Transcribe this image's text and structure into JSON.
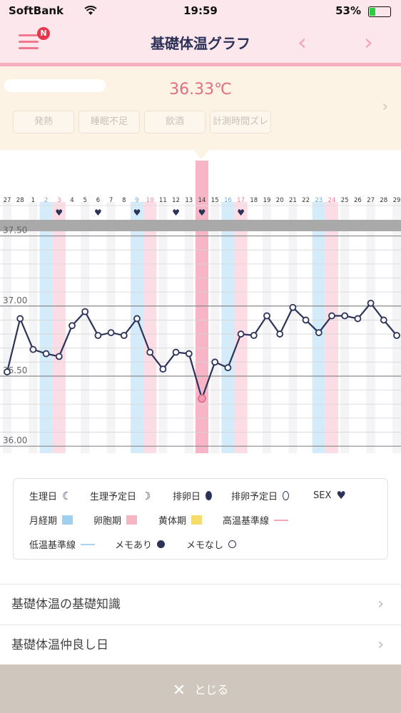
{
  "status_bar": {
    "carrier": "SoftBank",
    "time": "19:59",
    "battery": "53%"
  },
  "nav": {
    "badge": "N",
    "title": "基礎体温グラフ",
    "prev_icon": "chevron-left-icon",
    "next_icon": "chevron-right-icon"
  },
  "info_panel": {
    "temperature": "36.33℃",
    "chips": [
      "発熱",
      "睡眠不足",
      "飲酒",
      "計測時間ズレ"
    ]
  },
  "chart_data": {
    "type": "line",
    "days": [
      "27",
      "28",
      "1",
      "2",
      "3",
      "4",
      "5",
      "6",
      "7",
      "8",
      "9",
      "10",
      "11",
      "12",
      "13",
      "14",
      "15",
      "16",
      "17",
      "18",
      "19",
      "20",
      "21",
      "22",
      "23",
      "24",
      "25",
      "26",
      "27",
      "28",
      "29"
    ],
    "values": [
      36.53,
      36.91,
      36.69,
      36.66,
      36.64,
      36.86,
      36.96,
      36.79,
      36.81,
      36.79,
      36.91,
      36.67,
      36.55,
      36.67,
      36.66,
      36.34,
      36.6,
      36.56,
      36.8,
      36.79,
      36.93,
      36.8,
      36.99,
      36.9,
      36.81,
      36.93,
      36.93,
      36.91,
      37.02,
      36.9,
      36.79
    ],
    "y_ticks": [
      "37.50",
      "37.00",
      "36.50",
      "36.00"
    ],
    "ylim": [
      35.95,
      37.62
    ],
    "selected_day_index": 15,
    "sex_day_indices": [
      4,
      7,
      10,
      13,
      15,
      18
    ],
    "menstruation_day_indices": [
      3,
      10,
      17,
      24
    ],
    "follicular_day_indices": [
      4,
      11,
      18,
      25
    ],
    "colors": {
      "line": "#2c3258",
      "selected": "#f5a3b9",
      "blue": "#d4ecfa",
      "pink": "#fcdde5",
      "band": "#a9a9a9",
      "day_pink": "#f07b95",
      "day_blue": "#6fa8d6"
    }
  },
  "legend": {
    "period": "生理日",
    "period_expected": "生理予定日",
    "ovulation": "排卵日",
    "ovulation_expected": "排卵予定日",
    "sex": "SEX",
    "menstrual_phase": "月経期",
    "follicular_phase": "卵胞期",
    "luteal_phase": "黄体期",
    "high_baseline": "高温基準線",
    "low_baseline": "低温基準線",
    "memo_yes": "メモあり",
    "memo_no": "メモなし"
  },
  "info_list": [
    "基礎体温の基礎知識",
    "基礎体温仲良し日"
  ],
  "footer": {
    "close_label": "とじる"
  }
}
